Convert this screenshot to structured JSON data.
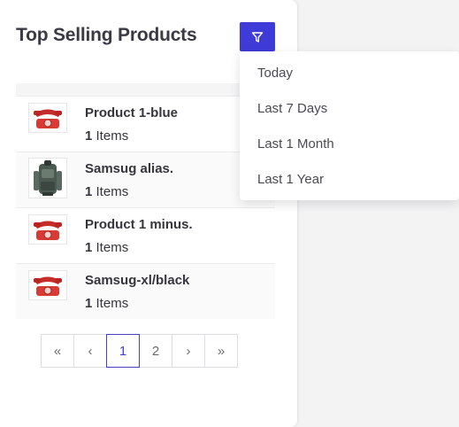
{
  "widget": {
    "title": "Top Selling Products",
    "filter_icon": "filter-icon",
    "accent_color": "#3e3bd8"
  },
  "products": [
    {
      "name": "Product 1-blue",
      "qty": "1",
      "unit": "Items",
      "image": "red-telephone"
    },
    {
      "name": "Samsug alias.",
      "qty": "1",
      "unit": "Items",
      "image": "backpack"
    },
    {
      "name": "Product 1 minus.",
      "qty": "1",
      "unit": "Items",
      "image": "red-telephone"
    },
    {
      "name": "Samsug-xl/black",
      "qty": "1",
      "unit": "Items",
      "image": "red-telephone"
    }
  ],
  "pagination": {
    "first": "«",
    "prev": "‹",
    "pages": [
      "1",
      "2"
    ],
    "current": "1",
    "next": "›",
    "last": "»"
  },
  "filter_menu": {
    "options": [
      "Today",
      "Last 7 Days",
      "Last 1 Month",
      "Last 1 Year"
    ]
  }
}
